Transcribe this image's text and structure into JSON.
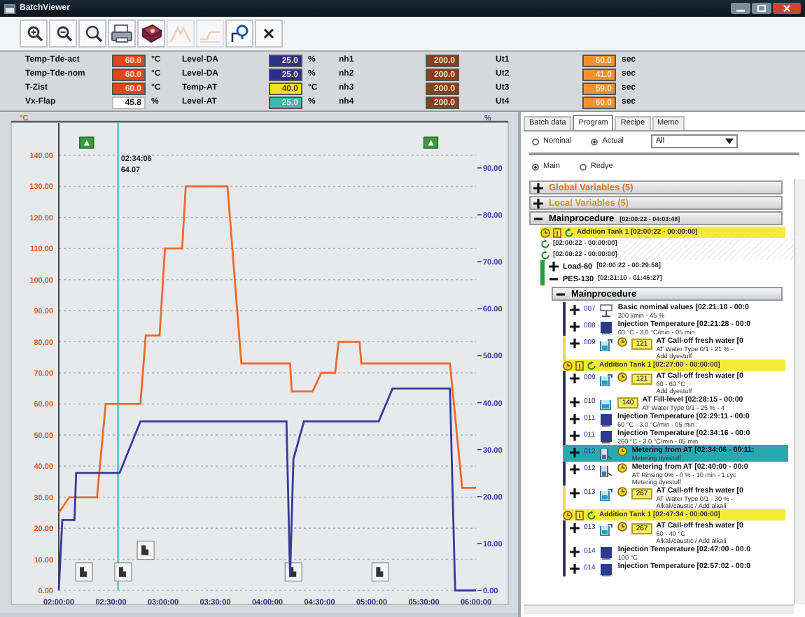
{
  "window": {
    "title": "BatchViewer"
  },
  "toolbar": [
    {
      "kind": "zoom-in",
      "disabled": false
    },
    {
      "kind": "zoom-out",
      "disabled": false
    },
    {
      "kind": "zoom-fit",
      "disabled": false
    },
    {
      "kind": "print",
      "disabled": false
    },
    {
      "kind": "book",
      "disabled": false
    },
    {
      "kind": "peak",
      "disabled": true
    },
    {
      "kind": "flat",
      "disabled": true
    },
    {
      "kind": "probe",
      "disabled": false
    },
    {
      "kind": "close",
      "disabled": false
    }
  ],
  "readings": [
    {
      "label": "Temp-Tde-act",
      "value": "60.0",
      "unit": "°C",
      "color": "#e0451c"
    },
    {
      "label": "Temp-Tde-nom",
      "value": "60.0",
      "unit": "°C",
      "color": "#e0451c"
    },
    {
      "label": "T-Zist",
      "value": "60.0",
      "unit": "°C",
      "color": "#e0451c"
    },
    {
      "label": "Vx-Flap",
      "value": "45.8",
      "unit": "%",
      "color": "#ffffff"
    },
    {
      "label": "Level-DA",
      "value": "25.0",
      "unit": "%",
      "color": "#2e2e8e"
    },
    {
      "label": "Level-DA",
      "value": "25.0",
      "unit": "%",
      "color": "#2e2e8e"
    },
    {
      "label": "Temp-AT",
      "value": "40.0",
      "unit": "°C",
      "color": "#f2e21c"
    },
    {
      "label": "Level-AT",
      "value": "25.0",
      "unit": "%",
      "color": "#3db6b4"
    },
    {
      "label": "nh1",
      "value": "200.0",
      "color": "#8e3c1c"
    },
    {
      "label": "nh2",
      "value": "200.0",
      "color": "#8e3c1c"
    },
    {
      "label": "nh3",
      "value": "200.0",
      "color": "#8e3c1c"
    },
    {
      "label": "nh4",
      "value": "200.0",
      "color": "#8e3c1c"
    },
    {
      "label": "Ut1",
      "value": "60.0",
      "unit": "sec",
      "color": "#f2922c"
    },
    {
      "label": "Ut2",
      "value": "41.0",
      "unit": "sec",
      "color": "#f2922c"
    },
    {
      "label": "Ut3",
      "value": "59.0",
      "unit": "sec",
      "color": "#f2922c"
    },
    {
      "label": "Ut4",
      "value": "60.0",
      "unit": "sec",
      "color": "#f2922c"
    }
  ],
  "chart_data": {
    "type": "line",
    "ylabel": "°C",
    "y2label": "%",
    "xlim": [
      2,
      6
    ],
    "ylim": [
      0,
      140
    ],
    "y2lim": [
      0,
      90
    ],
    "xticks": [
      {
        "value": 2,
        "label": "02:00:00"
      },
      {
        "value": 2.5,
        "label": "02:30:00"
      },
      {
        "value": 3,
        "label": "03:00:00"
      },
      {
        "value": 3.5,
        "label": "03:30:00"
      },
      {
        "value": 4,
        "label": "04:00:00"
      },
      {
        "value": 4.5,
        "label": "04:30:00"
      },
      {
        "value": 5,
        "label": "05:00:00"
      },
      {
        "value": 5.5,
        "label": "05:30:00"
      },
      {
        "value": 6,
        "label": "06:00:00"
      }
    ],
    "yticks": [
      {
        "value": 0,
        "label": "0.00"
      },
      {
        "value": 10,
        "label": "10.00"
      },
      {
        "value": 20,
        "label": "20.00"
      },
      {
        "value": 30,
        "label": "30.00"
      },
      {
        "value": 40,
        "label": "40.00"
      },
      {
        "value": 50,
        "label": "50.00"
      },
      {
        "value": 60,
        "label": "60.00"
      },
      {
        "value": 70,
        "label": "70.00"
      },
      {
        "value": 80,
        "label": "80.00"
      },
      {
        "value": 90,
        "label": "90.00"
      },
      {
        "value": 100,
        "label": "100.00"
      },
      {
        "value": 110,
        "label": "110.00"
      },
      {
        "value": 120,
        "label": "120.00"
      },
      {
        "value": 130,
        "label": "130.00"
      },
      {
        "value": 140,
        "label": "140.00"
      }
    ],
    "y2ticks": [
      {
        "value": 0,
        "label": "0.00"
      },
      {
        "value": 10,
        "label": "10.00"
      },
      {
        "value": 20,
        "label": "20.00"
      },
      {
        "value": 30,
        "label": "30.00"
      },
      {
        "value": 40,
        "label": "40.00"
      },
      {
        "value": 50,
        "label": "50.00"
      },
      {
        "value": 60,
        "label": "60.00"
      },
      {
        "value": 70,
        "label": "70.00"
      },
      {
        "value": 80,
        "label": "80.00"
      },
      {
        "value": 90,
        "label": "90.00"
      }
    ],
    "series": [
      {
        "color": "#f06a2a",
        "x": [
          2,
          2.1,
          2.367,
          2.45,
          2.783,
          2.833,
          2.967,
          3.017,
          3.183,
          3.217,
          3.617,
          3.75,
          4.217,
          4.233,
          4.433,
          4.517,
          4.65,
          4.683,
          4.883,
          4.9,
          5.75,
          5.867,
          6
        ],
        "values": [
          25,
          30,
          30,
          60,
          60,
          82,
          82,
          110,
          110,
          130,
          130,
          73,
          73,
          64,
          64,
          70,
          70,
          80,
          80,
          73,
          73,
          33,
          33
        ]
      },
      {
        "color": "#3a3a9a",
        "axis": "y2",
        "x": [
          2,
          2.033,
          2.15,
          2.167,
          2.583,
          2.783,
          4.183,
          4.217,
          4.25,
          4.35,
          5.067,
          5.2,
          5.75,
          5.8,
          6
        ],
        "values": [
          0,
          15,
          15,
          25,
          25,
          36,
          36,
          3,
          28,
          36,
          36,
          43,
          43,
          0,
          0
        ]
      }
    ],
    "grid": true,
    "ref_lines": [
      {
        "axis": "x",
        "value": 2.568,
        "color": "#70c4cc"
      }
    ],
    "annotations": [
      "02:34:06",
      "64.07"
    ]
  },
  "tabs": [
    {
      "label": "Batch data",
      "selected": false
    },
    {
      "label": "Program",
      "selected": true
    },
    {
      "label": "Recipe",
      "selected": false
    },
    {
      "label": "Memo",
      "selected": false
    }
  ],
  "view_mode": [
    {
      "label": "Nominal",
      "selected": false
    },
    {
      "label": "Actual",
      "selected": true
    }
  ],
  "filter": {
    "value": "All"
  },
  "program": [
    {
      "label": "Main",
      "selected": true
    },
    {
      "label": "Redye",
      "selected": false
    }
  ],
  "tree": [
    {
      "kind": "header",
      "label": "Global Variables (5)",
      "color": "#e07020",
      "expanded": false
    },
    {
      "kind": "header",
      "label": "Local Variables (5)",
      "color": "#c89a10",
      "expanded": false
    },
    {
      "kind": "header",
      "label": "Mainprocedure",
      "time": "[02:00:22 - 04:03:48]",
      "color": "#000000",
      "expanded": true,
      "children": [
        {
          "kind": "tank",
          "label": "Addition Tank 1 [02:00:22 - 00:00:00]"
        },
        {
          "kind": "time",
          "label": "[02:00:22 - 00:00:00]"
        },
        {
          "kind": "time",
          "label": "[02:00:22 - 00:00:00]"
        },
        {
          "kind": "node",
          "label": "Load-60",
          "time": "[02:00:22 - 00:29:58]",
          "expanded": false
        },
        {
          "kind": "node",
          "label": "PES-130",
          "time": "[02:21:10 - 01:46:27]",
          "expanded": true,
          "children": [
            {
              "kind": "header",
              "label": "Mainprocedure",
              "color": "#000000",
              "expanded": true,
              "children": [
                {
                  "kind": "values",
                  "number": "007",
                  "color": "#2e2e7e",
                  "expanded": false,
                  "selected": false,
                  "lines": [
                    "Basic nominal values [02:21:10 - 00:0",
                    "200 l/min - 45 %"
                  ]
                },
                {
                  "kind": "temperature",
                  "number": "008",
                  "color": "#2e2e7e",
                  "expanded": false,
                  "selected": false,
                  "lines": [
                    "Injection Temperature [02:21:28 - 00:0",
                    "60 °C - 3.0 °C/min - 05 min"
                  ]
                },
                {
                  "kind": "calloff",
                  "number": "009",
                  "badge": "121",
                  "color": "#e8d84a",
                  "expanded": false,
                  "selected": false,
                  "lines": [
                    "AT Call-off fresh water [0",
                    "AT Water Type 0/1 - 21 % -",
                    "Add dyestuff"
                  ]
                },
                {
                  "kind": "tank",
                  "label": "Addition Tank 1 [02:27:00 - 00:00:00]"
                },
                {
                  "kind": "calloff",
                  "number": "009",
                  "badge": "121",
                  "color": "#2e2e7e",
                  "expanded": false,
                  "selected": false,
                  "lines": [
                    "AT Call-off fresh water [0",
                    "60 - 60 °C",
                    "Add dyestuff"
                  ]
                },
                {
                  "kind": "fill",
                  "number": "010",
                  "badge": "140",
                  "color": "#2e2e7e",
                  "expanded": false,
                  "selected": false,
                  "lines": [
                    "AT Fill-level [02:28:15 - 00:00",
                    "AT Water Type 0/1 - 25 % - 4"
                  ]
                },
                {
                  "kind": "temperature",
                  "number": "011",
                  "color": "#2e2e7e",
                  "expanded": false,
                  "selected": false,
                  "lines": [
                    "Injection Temperature [02:29:11 - 00:0",
                    "60 °C - 3.0 °C/min - 05 min"
                  ]
                },
                {
                  "kind": "temperature",
                  "number": "011",
                  "color": "#2e2e7e",
                  "expanded": false,
                  "selected": false,
                  "lines": [
                    "Injection Temperature [02:34:16 - 00:0",
                    "260 °C - 3.0 °C/min - 05 min"
                  ]
                },
                {
                  "kind": "metering",
                  "number": "012",
                  "color": "#2aa8b0",
                  "expanded": false,
                  "selected": true,
                  "lines": [
                    "Metering from AT [02:34:06 - 00:11:",
                    "Metering dyestuff"
                  ]
                },
                {
                  "kind": "metering",
                  "number": "012",
                  "color": "#2e2e7e",
                  "expanded": false,
                  "selected": false,
                  "lines": [
                    "Metering from AT [02:40:00 - 00:0",
                    "AT Rinsing 0% - 0 % - 10 min - 1 cyc",
                    "Metering dyestuff"
                  ]
                },
                {
                  "kind": "calloff",
                  "number": "013",
                  "badge": "267",
                  "color": "#e8d84a",
                  "expanded": false,
                  "selected": false,
                  "lines": [
                    "AT Call-off fresh water [0",
                    "AT Water Type 0/1 - 30 % -",
                    "Alkali/caustic / Add alkali"
                  ]
                },
                {
                  "kind": "tank",
                  "label": "Addition Tank 1 [02:47:34 - 00:00:00]"
                },
                {
                  "kind": "calloff",
                  "number": "013",
                  "badge": "267",
                  "color": "#2e2e7e",
                  "expanded": false,
                  "selected": false,
                  "lines": [
                    "AT Call-off fresh water [0",
                    "60 - 40 °C",
                    "Alkali/caustic / Add alkali"
                  ]
                },
                {
                  "kind": "temperature",
                  "number": "014",
                  "color": "#2e2e7e",
                  "expanded": false,
                  "selected": false,
                  "lines": [
                    "Injection Temperature [02:47:00 - 00:0",
                    "100 °C"
                  ]
                },
                {
                  "kind": "temperature",
                  "number": "014",
                  "color": "#2e2e7e",
                  "expanded": false,
                  "selected": false,
                  "lines": [
                    "Injection Temperature [02:57:02 - 00:0"
                  ]
                }
              ]
            }
          ]
        }
      ]
    }
  ]
}
